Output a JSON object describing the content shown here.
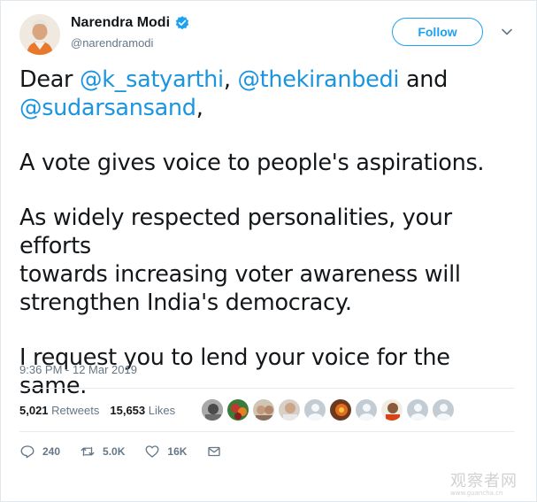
{
  "author": {
    "name": "Narendra Modi",
    "handle": "@narendramodi"
  },
  "follow_label": "Follow",
  "tweet": {
    "line1_prefix": "Dear ",
    "mention1": "@k_satyarthi",
    "sep1": ", ",
    "mention2": "@thekiranbedi",
    "sep2": " and",
    "mention3": "@sudarsansand",
    "sep3": ",",
    "para2": "A vote gives voice to people's aspirations.",
    "para3_line1": "As widely respected personalities, your efforts",
    "para3_line2": "towards increasing voter awareness will",
    "para3_line3": "strengthen India's democracy.",
    "para4": "I request you to lend your voice for the same."
  },
  "timestamp": "9:36 PM - 12 Mar 2019",
  "stats": {
    "retweets_count": "5,021",
    "retweets_label": "Retweets",
    "likes_count": "15,653",
    "likes_label": "Likes"
  },
  "likers_count": 10,
  "actions": {
    "reply_count": "240",
    "retweet_count": "5.0K",
    "like_count": "16K"
  },
  "watermark": {
    "text": "观察者网",
    "url": "www.guancha.cn"
  },
  "colors": {
    "accent": "#1da1f2",
    "mention": "#1b95e0",
    "muted": "#657786"
  }
}
